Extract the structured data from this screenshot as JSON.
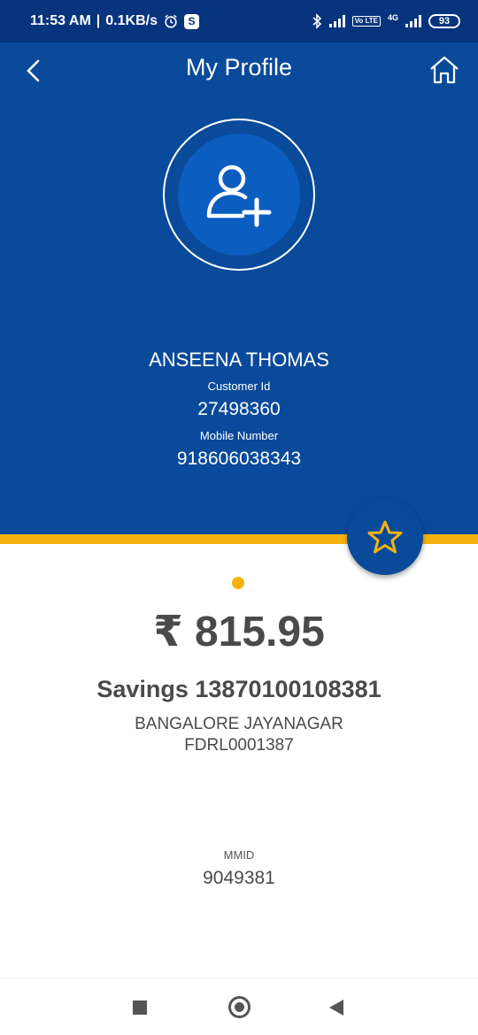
{
  "status_bar": {
    "time": "11:53 AM",
    "separator": "|",
    "data_speed": "0.1KB/s",
    "battery": "93",
    "network": "4G",
    "volte": "Vo LTE",
    "icons": [
      "alarm-icon",
      "skype-icon",
      "bluetooth-icon",
      "signal-icon",
      "volte-icon",
      "battery-icon"
    ]
  },
  "header": {
    "title": "My Profile",
    "back_icon": "chevron-left-icon",
    "home_icon": "home-icon"
  },
  "profile": {
    "avatar_icon": "add-user-icon",
    "name": "ANSEENA THOMAS",
    "customer_id_label": "Customer Id",
    "customer_id": "27498360",
    "mobile_label": "Mobile Number",
    "mobile": "918606038343"
  },
  "favorite_icon": "star-icon",
  "account": {
    "balance": "₹ 815.95",
    "account_line": "Savings 13870100108381",
    "branch": "BANGALORE JAYANAGAR",
    "ifsc": "FDRL0001387",
    "mmid_label": "MMID",
    "mmid": "9049381"
  },
  "colors": {
    "primary": "#0a4a9a",
    "status_bar": "#07347d",
    "accent": "#f6b30f",
    "text": "#4a4a4a"
  }
}
